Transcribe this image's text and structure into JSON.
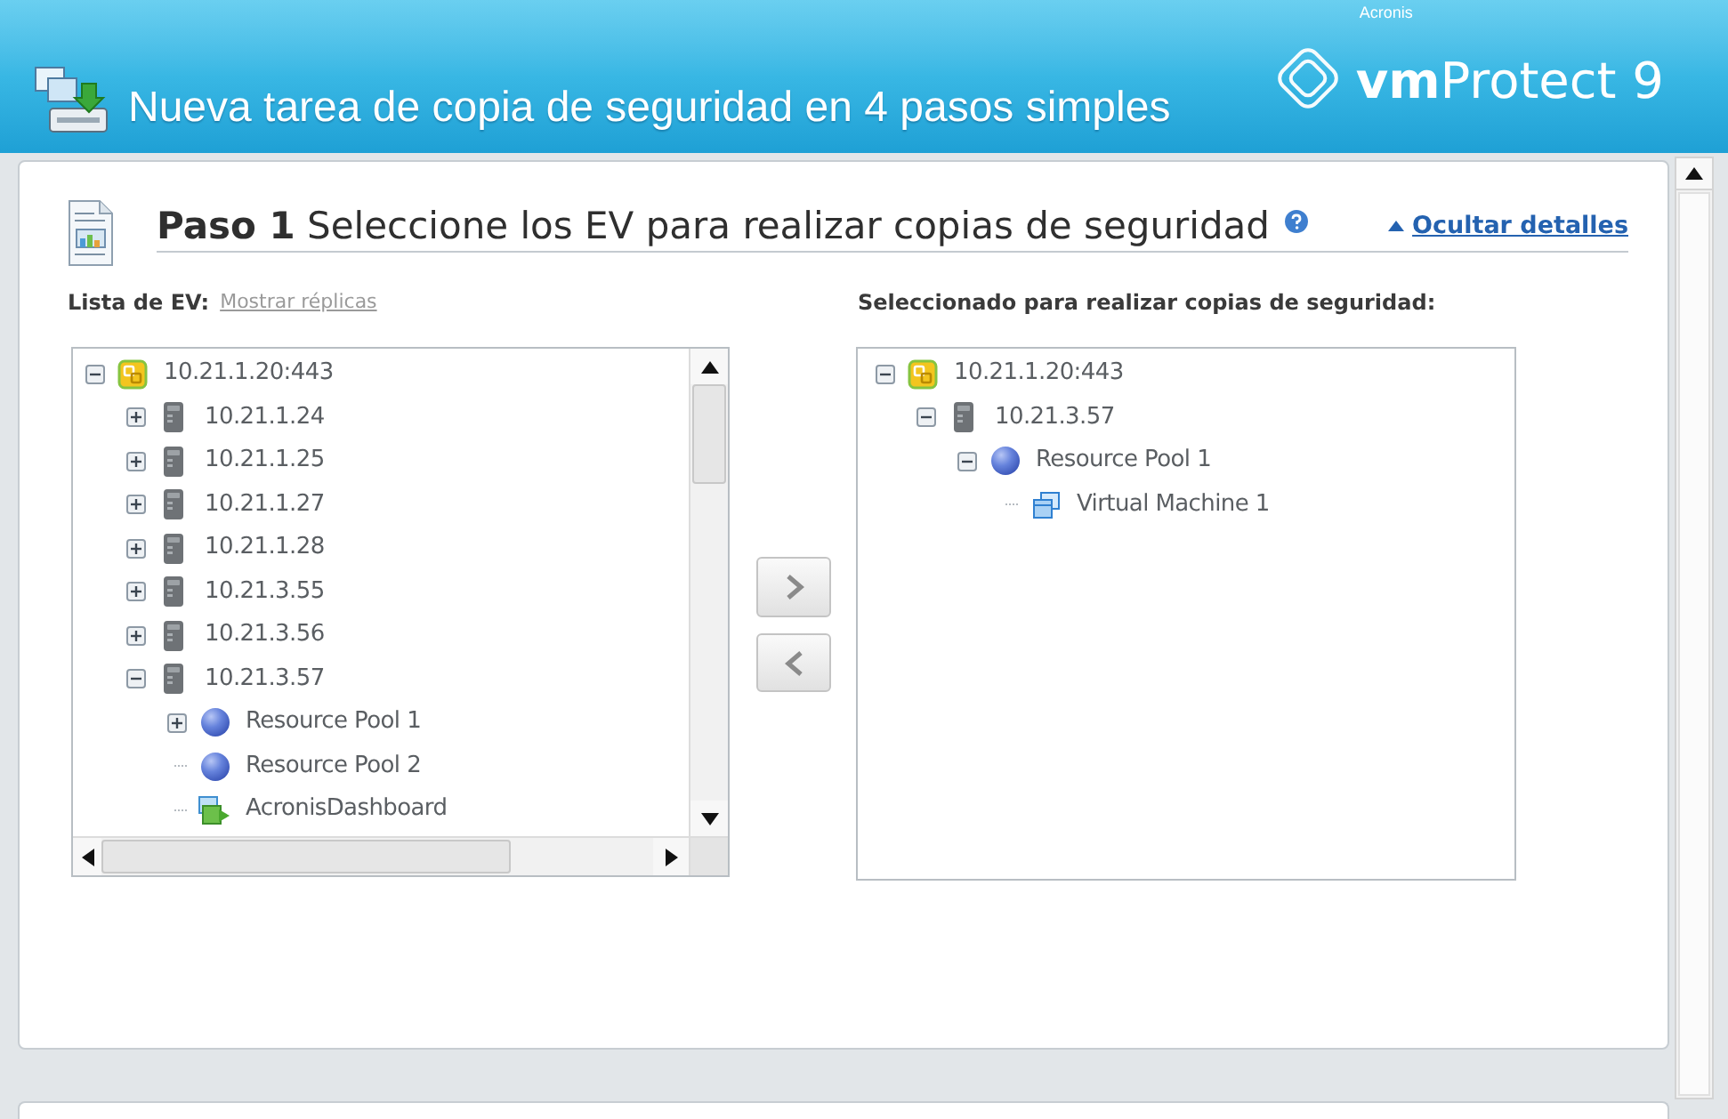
{
  "header": {
    "title": "Nueva tarea de copia de seguridad en 4 pasos simples",
    "logo": {
      "vendor": "Acronis",
      "product": "**vm**Protect 9"
    }
  },
  "step": {
    "heading": "**Paso 1** Seleccione los EV para realizar copias de seguridad",
    "details_link": {
      "label": "Ocultar detalles",
      "expanded": true
    }
  },
  "vm_list": {
    "label": "Lista de EV:",
    "link": "Mostrar réplicas",
    "tree": [
      {
        "label": "10.21.1.20:443",
        "kind": "vcenter",
        "expanded": true,
        "children": [
          {
            "label": "10.21.1.24",
            "kind": "host",
            "expanded": false
          },
          {
            "label": "10.21.1.25",
            "kind": "host",
            "expanded": false
          },
          {
            "label": "10.21.1.27",
            "kind": "host",
            "expanded": false
          },
          {
            "label": "10.21.1.28",
            "kind": "host",
            "expanded": false
          },
          {
            "label": "10.21.3.55",
            "kind": "host",
            "expanded": false
          },
          {
            "label": "10.21.3.56",
            "kind": "host",
            "expanded": false
          },
          {
            "label": "10.21.3.57",
            "kind": "host",
            "expanded": true,
            "children": [
              {
                "label": "Resource Pool 1",
                "kind": "pool",
                "expanded": false
              },
              {
                "label": "Resource Pool 2",
                "kind": "pool"
              },
              {
                "label": "AcronisDashboard",
                "kind": "vapp"
              }
            ]
          }
        ]
      }
    ]
  },
  "move_buttons": [
    {
      "kind": "add"
    },
    {
      "kind": "remove"
    }
  ],
  "selected_list": {
    "label": "Seleccionado para realizar copias de seguridad:",
    "tree": [
      {
        "label": "10.21.1.20:443",
        "kind": "vcenter",
        "expanded": true,
        "children": [
          {
            "label": "10.21.3.57",
            "kind": "host",
            "expanded": true,
            "children": [
              {
                "label": "Resource Pool 1",
                "kind": "pool",
                "expanded": true,
                "children": [
                  {
                    "label": "Virtual Machine 1",
                    "kind": "vm"
                  }
                ]
              }
            ]
          }
        ]
      }
    ]
  }
}
